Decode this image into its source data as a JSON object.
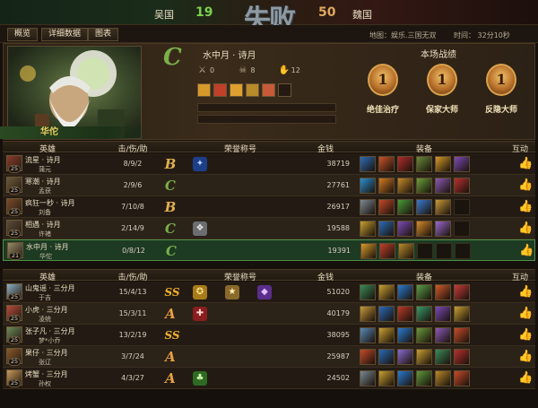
{
  "topbar": {
    "team_left": "吴国",
    "score_left": "19",
    "result": "失败",
    "score_right": "50",
    "team_right": "魏国"
  },
  "tabs": [
    {
      "label": "概览"
    },
    {
      "label": "详细数据"
    },
    {
      "label": "图表"
    }
  ],
  "match_info": {
    "map": "地图：娱乐.三国无双",
    "time": "时间：  32分10秒"
  },
  "hero": {
    "name": "华佗",
    "grade": "C",
    "player": "水中月 · 诗月",
    "kills": "0",
    "deaths": "8",
    "assists": "12"
  },
  "achievements": {
    "title": "本场战绩",
    "items": [
      {
        "label": "绝佳治疗",
        "rank": "1"
      },
      {
        "label": "保家大师",
        "rank": "1"
      },
      {
        "label": "反隐大师",
        "rank": "1"
      }
    ]
  },
  "table_headers": {
    "hero": "英雄",
    "kda": "击/伤/助",
    "honor": "荣誉称号",
    "gold": "金钱",
    "equip": "装备",
    "interact": "互动"
  },
  "team_a": [
    {
      "player": "流星 · 诗月",
      "hero": "蒲元",
      "level": "25",
      "kda": "8/9/2",
      "grade": "B",
      "honors": [
        "blue"
      ],
      "gold": "38719",
      "items": [
        "#2d6db8",
        "#c7542a",
        "#b22c2c",
        "#6a8a3a",
        "#d69a2a",
        "#7c4bb8"
      ]
    },
    {
      "player": "寒潮 · 诗月",
      "hero": "孟获",
      "level": "25",
      "kda": "2/9/6",
      "grade": "C",
      "honors": [],
      "gold": "27761",
      "items": [
        "#2a8fd0",
        "#d47a22",
        "#c58a2a",
        "#6aa03a",
        "#8b5ab5",
        "#b83030"
      ]
    },
    {
      "player": "疯狂一秒 · 诗月",
      "hero": "刘备",
      "level": "25",
      "kda": "7/10/8",
      "grade": "B",
      "honors": [],
      "gold": "26917",
      "items": [
        "#7c8a94",
        "#c24a2a",
        "#4a9a3a",
        "#3a7ad0",
        "#c89a3a",
        "#2a2a2a"
      ]
    },
    {
      "player": "相遇 · 诗月",
      "hero": "许褚",
      "level": "25",
      "kda": "2/14/9",
      "grade": "C",
      "honors": [
        "silver"
      ],
      "gold": "19588",
      "items": [
        "#c8a032",
        "#2c6cb8",
        "#7c4bb8",
        "#d68a2a",
        "#9a6ad0",
        "#2a2a2a"
      ]
    },
    {
      "player": "水中月 · 诗月",
      "hero": "华佗",
      "level": "21",
      "kda": "0/8/12",
      "grade": "C",
      "honors": [],
      "gold": "19391",
      "me": true,
      "items": [
        "#d69a2a",
        "#c0402a",
        "#b88a2a",
        "#2a2a2a",
        "#2a2a2a",
        "#2a2a2a"
      ]
    }
  ],
  "team_b": [
    {
      "player": "山鬼谣 · 三分月",
      "hero": "于吉",
      "level": "25",
      "kda": "15/4/13",
      "grade": "SS",
      "honors": [
        "gold",
        "star",
        "purple"
      ],
      "gold": "51020",
      "items": [
        "#3a8a5a",
        "#c8a032",
        "#2a7ad0",
        "#5aa04a",
        "#d05a2a",
        "#c83a3a"
      ]
    },
    {
      "player": "小虎 · 三分月",
      "hero": "凌统",
      "level": "25",
      "kda": "15/3/11",
      "grade": "A",
      "honors": [
        "red"
      ],
      "gold": "40179",
      "items": [
        "#c89a3a",
        "#2a6ab8",
        "#b83a2a",
        "#3a9a6a",
        "#7a4ab8",
        "#c8a032"
      ]
    },
    {
      "player": "张子凡 · 三分月",
      "hero": "梦*小乔",
      "level": "25",
      "kda": "13/2/19",
      "grade": "SS",
      "honors": [],
      "gold": "38095",
      "items": [
        "#5a8ab8",
        "#c8a032",
        "#2a7ad0",
        "#6a9a3a",
        "#8a5ab8",
        "#c84a2a"
      ]
    },
    {
      "player": "果仔 · 三分月",
      "hero": "张辽",
      "level": "25",
      "kda": "3/7/24",
      "grade": "A",
      "honors": [],
      "gold": "25987",
      "items": [
        "#c84a2a",
        "#2a6ab8",
        "#8a6ad0",
        "#c8a032",
        "#3a8a5a",
        "#b83030"
      ]
    },
    {
      "player": "烤蟹 · 三分月",
      "hero": "孙权",
      "level": "25",
      "kda": "4/3/27",
      "grade": "A",
      "honors": [
        "green"
      ],
      "gold": "24502",
      "items": [
        "#7a8a94",
        "#c8a032",
        "#2a7ad0",
        "#5a9a3a",
        "#b88a2a",
        "#c84a2a"
      ]
    }
  ],
  "colors": {
    "grade_C": "#7ab04a",
    "grade_B": "#e0b050",
    "grade_A": "#e8a040",
    "grade_SS": "#f0b030",
    "accent_green": "#7bd14b"
  }
}
